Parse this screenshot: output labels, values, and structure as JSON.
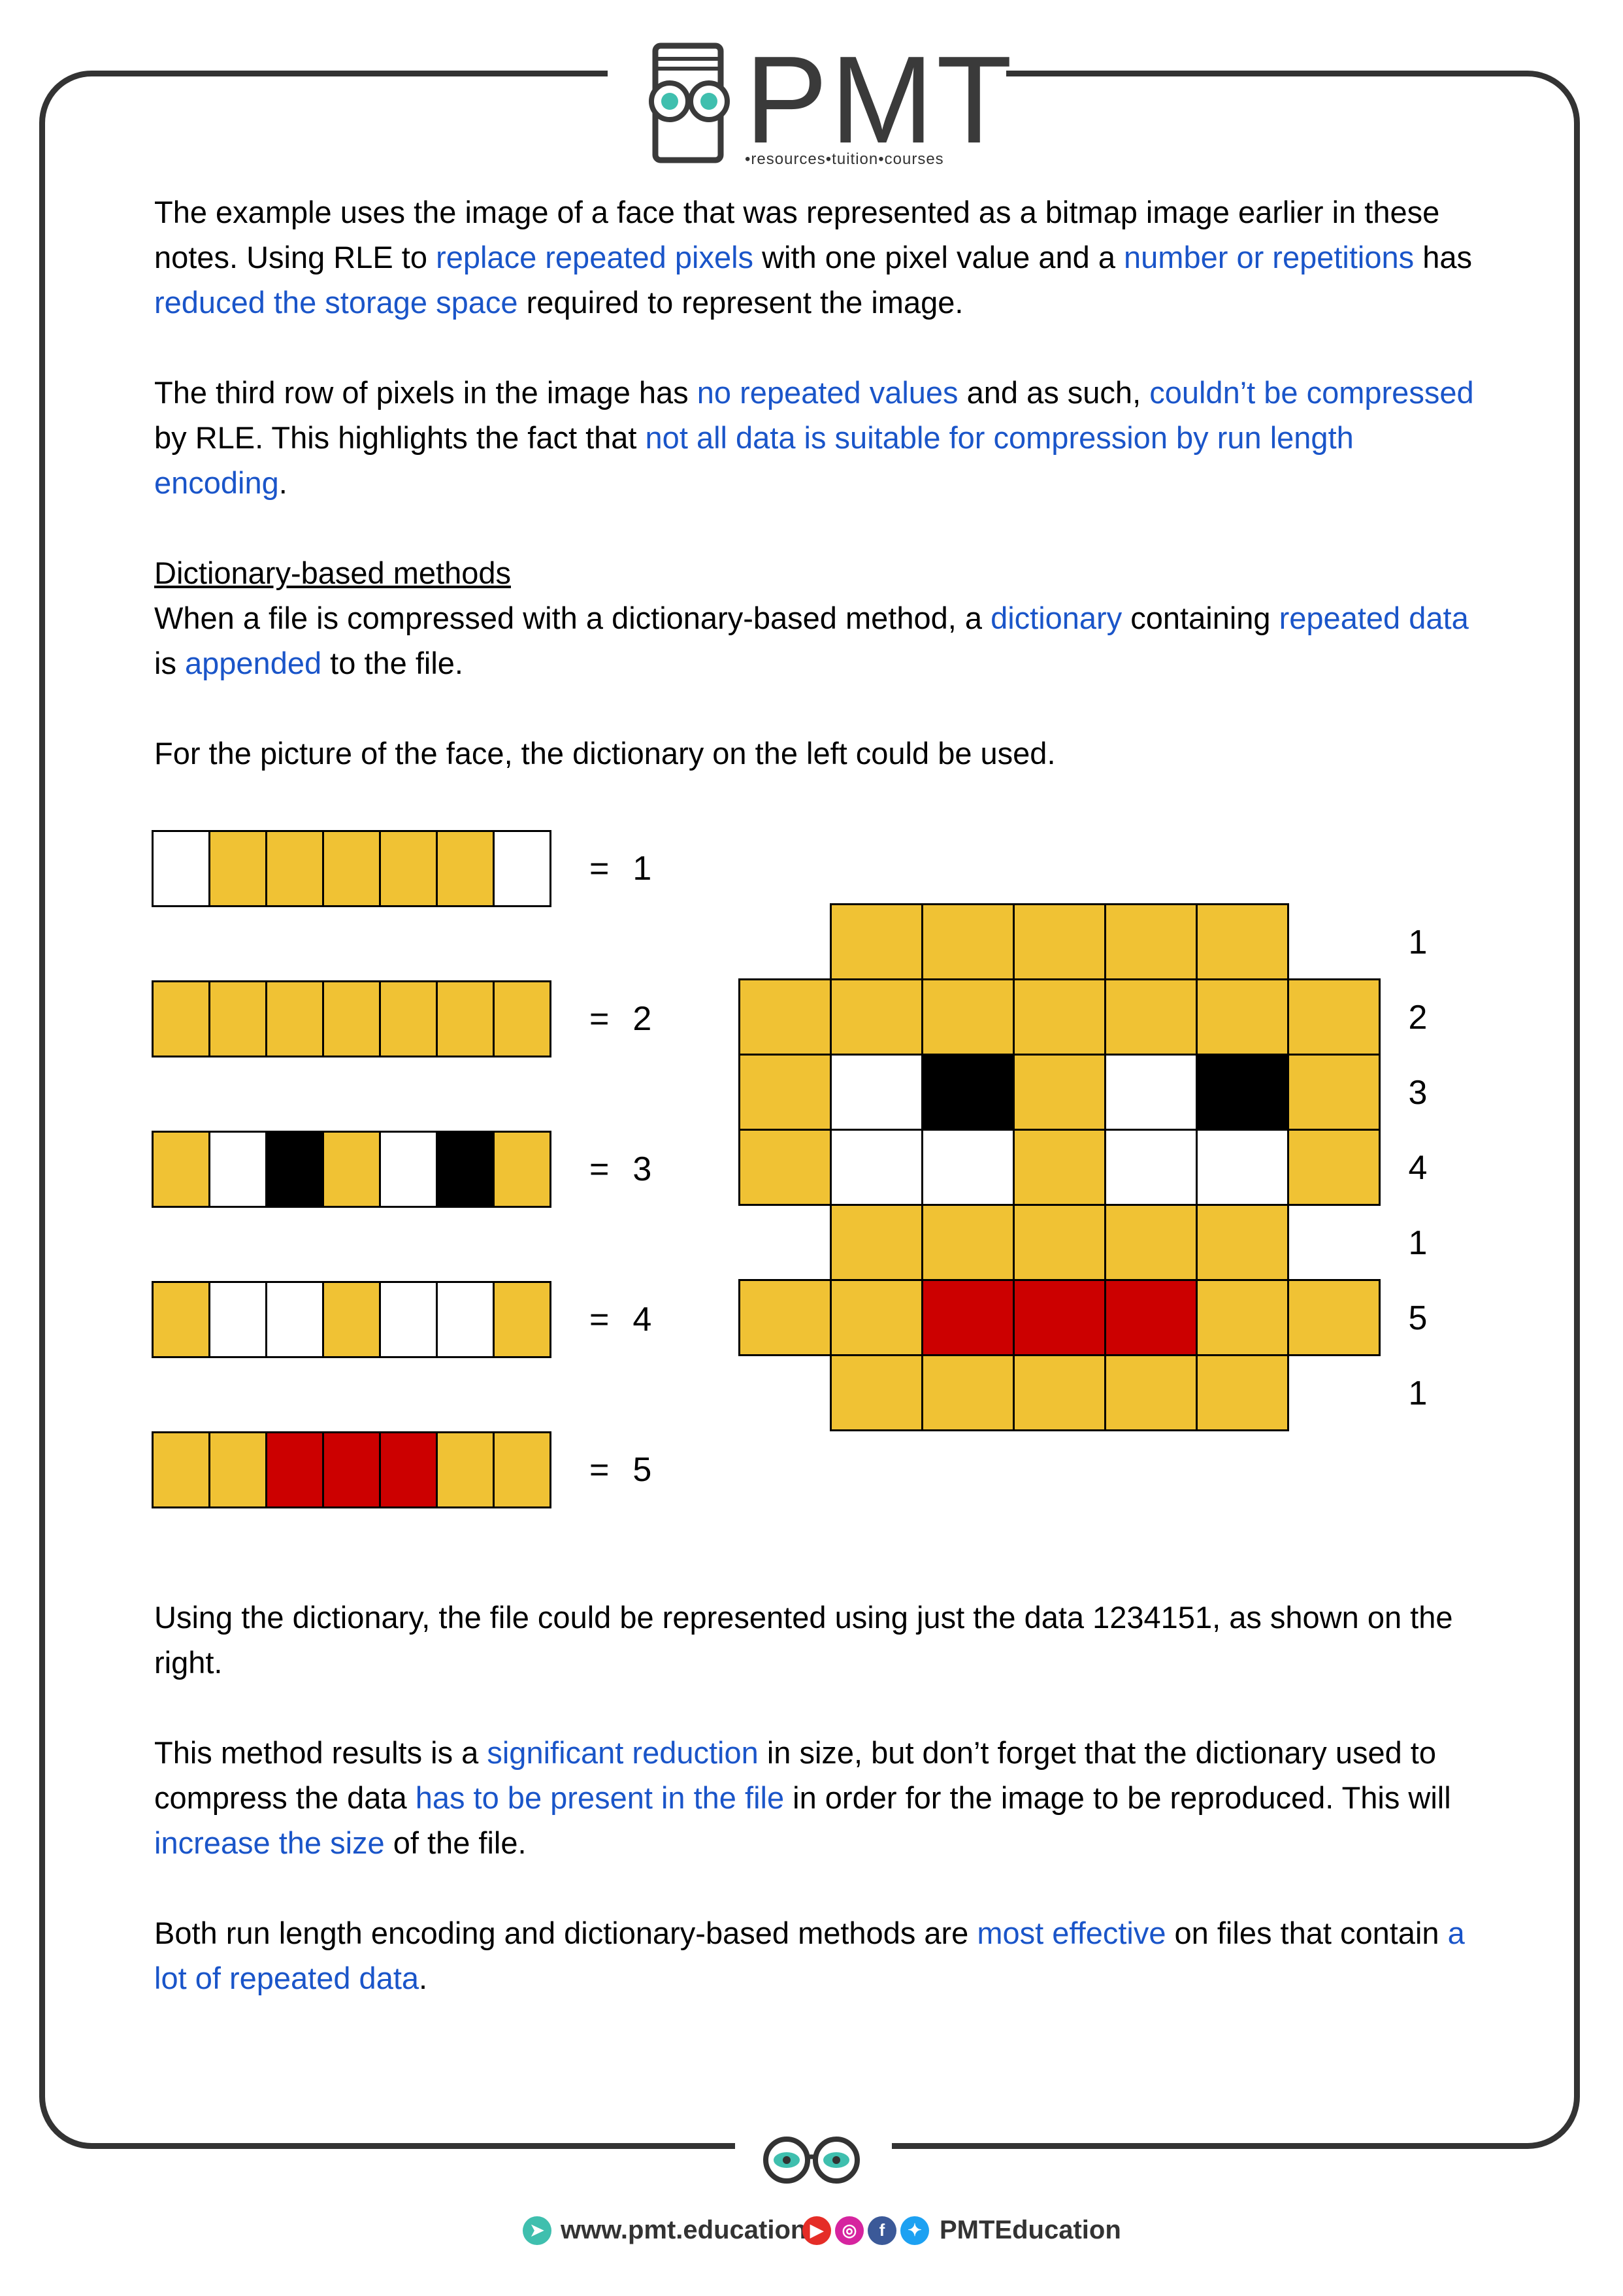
{
  "header": {
    "logo_text": "PMT",
    "logo_tagline": "•resources•tuition•courses"
  },
  "para1": {
    "t1": "The example uses the image of a face that was represented as a bitmap image earlier in these notes. Using RLE to ",
    "h1": "replace repeated pixels",
    "t2": " with one pixel value and a ",
    "h2": "number or repetitions",
    "t3": " has ",
    "h3": "reduced the storage space",
    "t4": " required to represent the image."
  },
  "para2": {
    "t1": "The third row of pixels in the image has ",
    "h1": "no repeated values",
    "t2": " and as such, ",
    "h2": "couldn’t be compressed",
    "t3": " by RLE. This highlights the fact that ",
    "h3": "not all data is suitable for compression by run length encoding",
    "t4": "."
  },
  "section": {
    "heading": "Dictionary-based methods",
    "t1": "When a file is compressed with a dictionary-based method, a ",
    "h1": "dictionary",
    "t2": " containing ",
    "h2": "repeated data",
    "t3": " is ",
    "h3": "appended",
    "t4": " to the file."
  },
  "para3": "For the picture of the face, the dictionary on the left could be used.",
  "dictionary": [
    {
      "cells": [
        "w",
        "y",
        "y",
        "y",
        "y",
        "y",
        "w"
      ],
      "eq": "=",
      "value": "1"
    },
    {
      "cells": [
        "y",
        "y",
        "y",
        "y",
        "y",
        "y",
        "y"
      ],
      "eq": "=",
      "value": "2"
    },
    {
      "cells": [
        "y",
        "w",
        "k",
        "y",
        "w",
        "k",
        "y"
      ],
      "eq": "=",
      "value": "3"
    },
    {
      "cells": [
        "y",
        "w",
        "w",
        "y",
        "w",
        "w",
        "y"
      ],
      "eq": "=",
      "value": "4"
    },
    {
      "cells": [
        "y",
        "y",
        "r",
        "r",
        "r",
        "y",
        "y"
      ],
      "eq": "=",
      "value": "5"
    }
  ],
  "face_rows": [
    "1",
    "2",
    "3",
    "4",
    "1",
    "5",
    "1"
  ],
  "colors": {
    "yellow": "#f0c234",
    "black": "#000000",
    "white": "#ffffff",
    "red": "#cc0000",
    "highlight": "#1a55c9"
  },
  "para4": "Using the dictionary, the file could be represented using just the data 1234151, as shown on the right.",
  "para5": {
    "t1": "This method results is a ",
    "h1": "significant reduction",
    "t2": " in size, but don’t forget that the dictionary used to compress the data ",
    "h2": "has to be present in the file",
    "t3": " in order for the image to be reproduced. This will ",
    "h3": "increase the size",
    "t4": " of the file."
  },
  "para6": {
    "t1": "Both run length encoding and dictionary-based methods are ",
    "h1": "most effective",
    "t2": " on files that contain ",
    "h2": "a lot of repeated data",
    "t3": "."
  },
  "footer": {
    "website": "www.pmt.education",
    "social_handle": "PMTEducation",
    "icons": [
      "cursor-icon",
      "youtube-icon",
      "instagram-icon",
      "facebook-icon",
      "twitter-icon"
    ]
  }
}
